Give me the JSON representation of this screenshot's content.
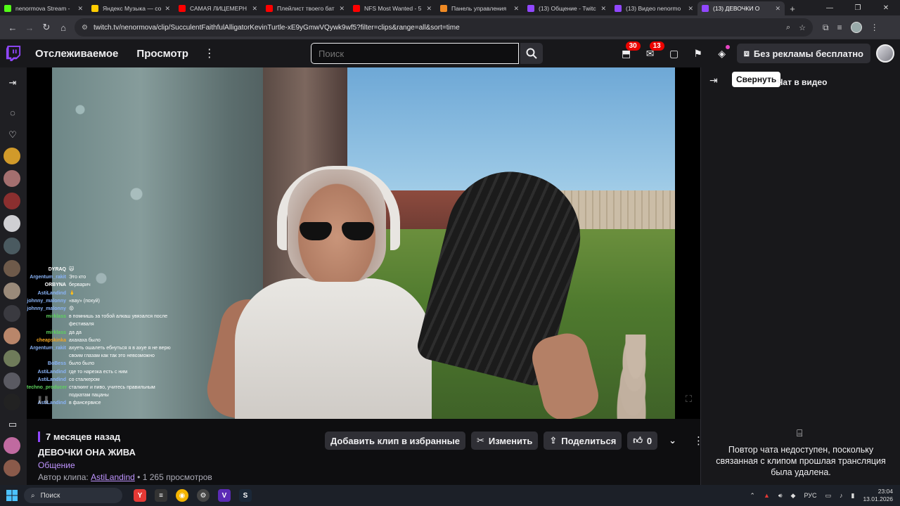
{
  "browser": {
    "tabs": [
      {
        "label": "nenormova Stream - ",
        "fav_color": "#53fc18"
      },
      {
        "label": "Яндекс Музыка — со",
        "fav_color": "#ffcc00"
      },
      {
        "label": "САМАЯ ЛИЦЕМЕРН",
        "fav_color": "#ff0000"
      },
      {
        "label": "Плейлист твоего бат",
        "fav_color": "#ff0000"
      },
      {
        "label": "NFS Most Wanted - 5",
        "fav_color": "#ff0000"
      },
      {
        "label": "Панель управления",
        "fav_color": "#f08a24"
      },
      {
        "label": "(13) Общение - Twitc",
        "fav_color": "#9147ff"
      },
      {
        "label": "(13) Видео nenormo",
        "fav_color": "#9147ff"
      },
      {
        "label": "(13) ДЕВОЧКИ О",
        "fav_color": "#9147ff",
        "active": true
      }
    ],
    "url": "twitch.tv/nenormova/clip/SucculentFaithfulAlligatorKevinTurtle-xE9yGmwVQywk9wf5?filter=clips&range=all&sort=time"
  },
  "twitch_nav": {
    "following": "Отслеживаемое",
    "browse": "Просмотр",
    "search_placeholder": "Поиск",
    "inbox_badge": "30",
    "whispers_badge": "13",
    "adfree": "Без рекламы бесплатно"
  },
  "clip": {
    "ago": "7 месяцев назад",
    "title": "ДЕВОЧКИ ОНА ЖИВА",
    "category": "Общение",
    "author_prefix": "Автор клипа:",
    "author": "AstiLandind",
    "views": "• 1 265 просмотров",
    "add_fav": "Добавить клип в избранные",
    "edit": "Изменить",
    "share": "Поделиться",
    "likes": "0"
  },
  "chat_overlay": [
    {
      "user": "DYRAQ",
      "color": "#ffffff",
      "text": "🙀"
    },
    {
      "user": "Argentum_rakit",
      "color": "#8ab4f8",
      "text": "Это кто"
    },
    {
      "user": "ORBYNA",
      "color": "#ffffff",
      "text": "берварич"
    },
    {
      "user": "AstiLandind",
      "color": "#8ab4f8",
      "text": "🙏"
    },
    {
      "user": "johnny_malonny",
      "color": "#8ab4f8",
      "text": "«вау» (похуй)"
    },
    {
      "user": "johnny_malonny",
      "color": "#8ab4f8",
      "text": "😡"
    },
    {
      "user": "mirklass",
      "color": "#5fd35f",
      "text": "в помнишь за тобой алкаш увязался после"
    },
    {
      "user": "",
      "color": "#ffffff",
      "text": "фестиваля"
    },
    {
      "user": "mirklass",
      "color": "#5fd35f",
      "text": "да да"
    },
    {
      "user": "cheapskinka",
      "color": "#f5a623",
      "text": "ахахаха было"
    },
    {
      "user": "Argentum_rakit",
      "color": "#8ab4f8",
      "text": "ахуеть ошалеть ебнуться я в ахуе я не верю"
    },
    {
      "user": "",
      "color": "#ffffff",
      "text": "своим глазам как так это невозможно"
    },
    {
      "user": "BoBess",
      "color": "#8ab4f8",
      "text": "было было"
    },
    {
      "user": "AstiLandind",
      "color": "#8ab4f8",
      "text": "где то нарезка есть с ним"
    },
    {
      "user": "AstiLandind",
      "color": "#8ab4f8",
      "text": "со сталкером"
    },
    {
      "user": "techno_producer",
      "color": "#5fd35f",
      "text": "сталкинг и пиво, учитесь правильным"
    },
    {
      "user": "",
      "color": "#ffffff",
      "text": "подкатам пацаны"
    },
    {
      "user": "AstiLandind",
      "color": "#8ab4f8",
      "text": "в фансервисе"
    }
  ],
  "chat_panel": {
    "tooltip": "Свернуть",
    "title": "Чат в видео",
    "unavailable": "Повтор чата недоступен, поскольку связанная с клипом прошлая трансляция была удалена."
  },
  "taskbar": {
    "search": "Поиск",
    "lang": "РУС",
    "time": "23:04",
    "date": "13.01.2026"
  },
  "colors": {
    "accent": "#9147ff",
    "link": "#bf94ff",
    "badge": "#eb0400"
  }
}
